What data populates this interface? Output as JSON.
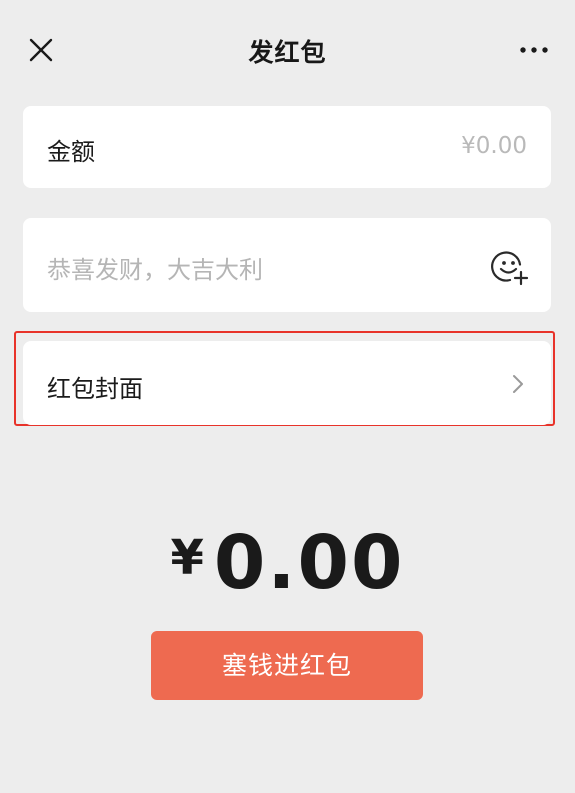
{
  "header": {
    "title": "发红包",
    "close_icon": "close-icon",
    "more_icon": "more-dots-icon"
  },
  "amount": {
    "label": "金额",
    "placeholder": "¥0.00"
  },
  "greeting": {
    "placeholder": "恭喜发财，大吉大利",
    "emoji_icon": "emoji-add-icon"
  },
  "cover": {
    "label": "红包封面",
    "chevron_icon": "chevron-right-icon",
    "highlight_color": "#e8332a"
  },
  "total": {
    "currency": "¥",
    "value": "0.00"
  },
  "submit": {
    "label": "塞钱进红包",
    "color": "#ee6a50"
  },
  "colors": {
    "background": "#ededed",
    "card": "#ffffff"
  }
}
